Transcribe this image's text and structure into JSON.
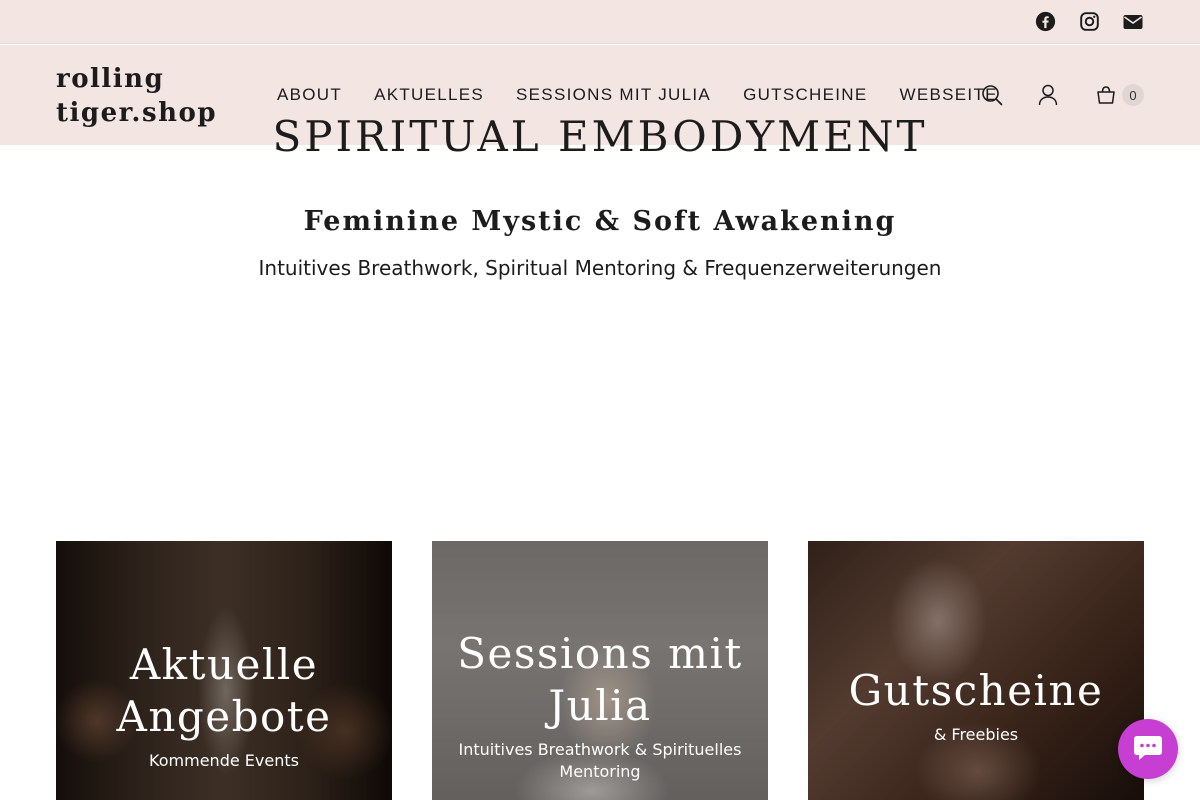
{
  "topbar": {
    "social": [
      {
        "icon": "facebook-icon"
      },
      {
        "icon": "instagram-icon"
      },
      {
        "icon": "mail-icon"
      }
    ]
  },
  "header": {
    "logo_line1": "rolling",
    "logo_line2": "tiger.shop",
    "nav": [
      {
        "label": "ABOUT"
      },
      {
        "label": "AKTUELLES"
      },
      {
        "label": "SESSIONS MIT JULIA"
      },
      {
        "label": "GUTSCHEINE"
      },
      {
        "label": "WEBSEITE"
      }
    ],
    "cart_count": "0"
  },
  "hero": {
    "title": "SPIRITUAL EMBODYMENT",
    "subtitle": "Feminine Mystic & Soft Awakening",
    "text": "Intuitives Breathwork, Spiritual Mentoring & Frequenzerweiterungen"
  },
  "cards": [
    {
      "title_line1": "Aktuelle",
      "title_line2": "Angebote",
      "subtitle": "Kommende Events"
    },
    {
      "title_line1": "Sessions mit",
      "title_line2": "Julia",
      "subtitle_line1": "Intuitives Breathwork & Spirituelles",
      "subtitle_line2": "Mentoring"
    },
    {
      "title_line1": "Gutscheine",
      "subtitle": "& Freebies"
    }
  ],
  "colors": {
    "header_bg": "#f2e5e2",
    "text": "#1c1c1c",
    "chat_button": "#c63ed2"
  }
}
